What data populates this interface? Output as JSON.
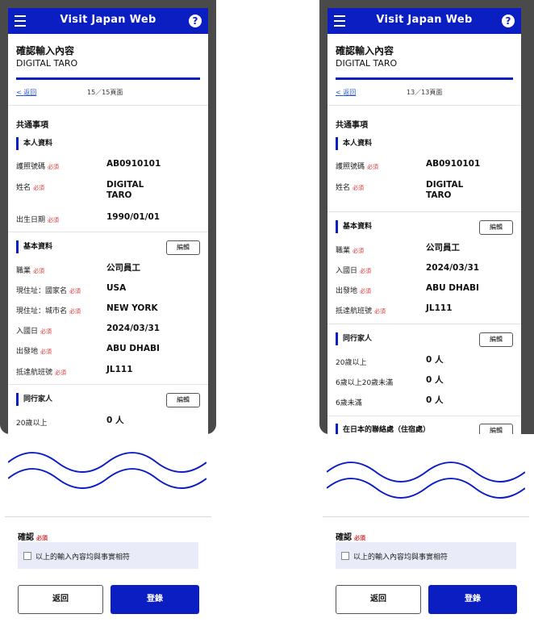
{
  "app_title": "Visit Japan Web",
  "help_glyph": "?",
  "page_title": "確認輸入內容",
  "user_name": "DIGITAL TARO",
  "back_link": "返回",
  "common_section": "共通事項",
  "required": "必須",
  "edit_label": "編輯",
  "left": {
    "page_indicator": "15／15頁面",
    "personal": {
      "title": "本人資料",
      "passport_label": "護照號碼",
      "passport_value": "AB0910101",
      "name_label": "姓名",
      "name_value_1": "DIGITAL",
      "name_value_2": "TARO",
      "dob_label": "出生日期",
      "dob_value": "1990/01/01"
    },
    "basic": {
      "title": "基本資料",
      "occupation_label": "職業",
      "occupation_value": "公司員工",
      "country_label": "現住址：國家名",
      "country_value": "USA",
      "city_label": "現住址：城市名",
      "city_value": "NEW YORK",
      "entry_label": "入國日",
      "entry_value": "2024/03/31",
      "departure_label": "出發地",
      "departure_value": "ABU DHABI",
      "flight_label": "抵達航班號",
      "flight_value": "JL111"
    },
    "family": {
      "title": "同行家人",
      "adult_label": "20歲以上",
      "adult_value": "0 人"
    }
  },
  "right": {
    "page_indicator": "13／13頁面",
    "personal": {
      "title": "本人資料",
      "passport_label": "護照號碼",
      "passport_value": "AB0910101",
      "name_label": "姓名",
      "name_value_1": "DIGITAL",
      "name_value_2": "TARO"
    },
    "basic": {
      "title": "基本資料",
      "occupation_label": "職業",
      "occupation_value": "公司員工",
      "entry_label": "入國日",
      "entry_value": "2024/03/31",
      "departure_label": "出發地",
      "departure_value": "ABU DHABI",
      "flight_label": "抵達航班號",
      "flight_value": "JL111"
    },
    "family": {
      "title": "同行家人",
      "adult_label": "20歲以上",
      "adult_value": "0 人",
      "teen_label": "6歲以上20歲未滿",
      "teen_value": "0 人",
      "child_label": "6歲未滿",
      "child_value": "0 人"
    },
    "contact_title": "在日本的聯絡處（住宿處）"
  },
  "confirm": {
    "label": "確認",
    "checkbox_text": "以上的輸入內容均與事實相符",
    "back_button": "返回",
    "register_button": "登錄"
  },
  "colors": {
    "brand": "#0b1ec2",
    "required": "#dd3333",
    "frame": "#4a4a4a"
  }
}
